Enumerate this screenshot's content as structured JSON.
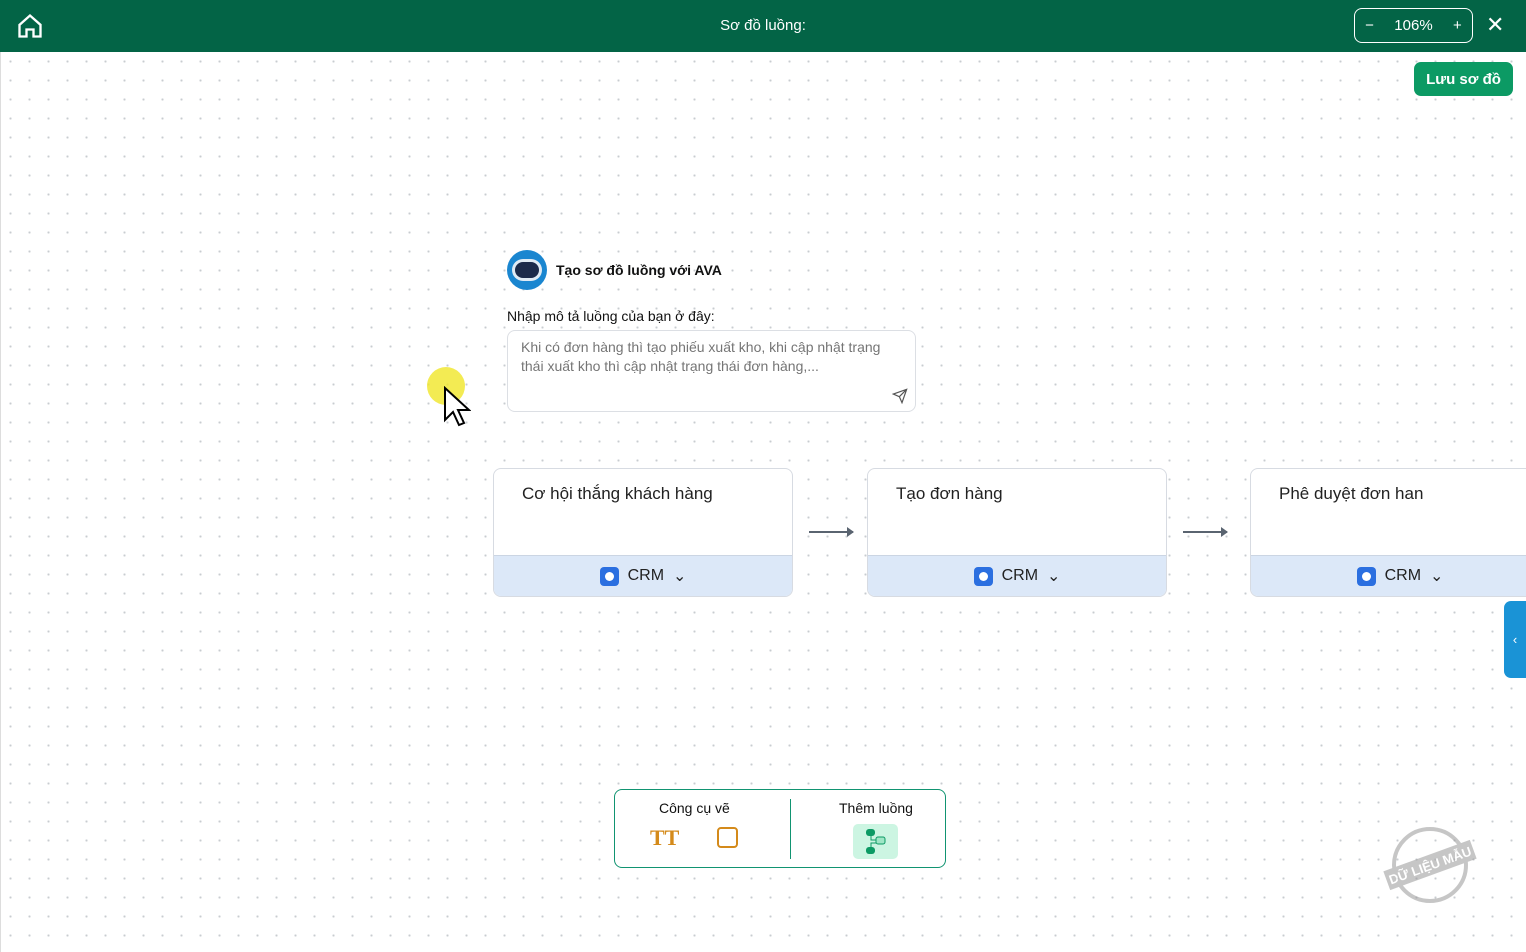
{
  "header": {
    "title": "Sơ đồ luồng:",
    "zoom": "106%",
    "zoom_out": "−",
    "zoom_in": "+",
    "close": "✕"
  },
  "toolbar": {
    "save_label": "Lưu sơ đồ"
  },
  "ava": {
    "title": "Tạo sơ đồ luồng với AVA",
    "label": "Nhập mô tả luồng của bạn ở đây:",
    "placeholder": "Khi có đơn hàng thì tạo phiếu xuất kho, khi cập nhật trạng thái xuất kho thì cập nhật trạng thái đơn hàng,..."
  },
  "nodes": [
    {
      "title": "Cơ hội thắng khách hàng",
      "app": "CRM"
    },
    {
      "title": "Tạo đơn hàng",
      "app": "CRM"
    },
    {
      "title": "Phê duyệt đơn han",
      "app": "CRM"
    }
  ],
  "side_tab": "‹",
  "tools": {
    "draw_label": "Công cụ vẽ",
    "text_tool": "TT",
    "add_flow_label": "Thêm luồng"
  },
  "watermark": "DỮ LIỆU MẪU",
  "colors": {
    "header": "#036446",
    "accent": "#0c9a64",
    "node_footer": "#dce8f8"
  }
}
